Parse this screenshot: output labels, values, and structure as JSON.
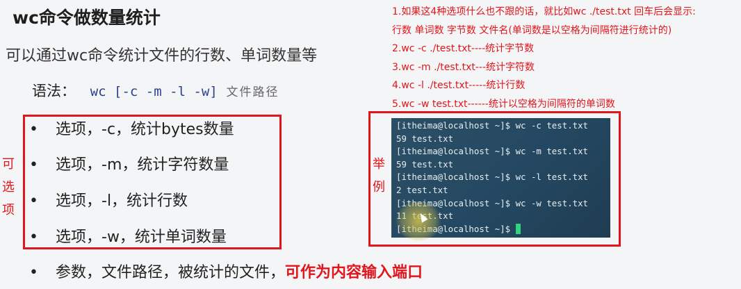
{
  "title": "wc命令做数量统计",
  "subtitle": "可以通过wc命令统计文件的行数、单词数量等",
  "syntax": {
    "label": "语法：",
    "code_cmd": "wc [",
    "opt_c": "-c",
    "opt_m": "-m",
    "opt_l": "-l",
    "opt_w": "-w",
    "code_end": "]",
    "path": "文件路径"
  },
  "options": [
    {
      "bullet": "•",
      "text": "选项，-c，统计bytes数量"
    },
    {
      "bullet": "•",
      "text": "选项，-m，统计字符数量"
    },
    {
      "bullet": "•",
      "text": "选项，-l，统计行数"
    },
    {
      "bullet": "•",
      "text": "选项，-w，统计单词数量"
    }
  ],
  "param": {
    "bullet": "•",
    "text": "参数，文件路径，被统计的文件，",
    "highlight": "可作为内容输入端口"
  },
  "side_labels": {
    "left": [
      "可",
      "选",
      "项"
    ],
    "right": [
      "举",
      "例"
    ]
  },
  "notes": [
    "1.如果这4种选项什么也不跟的话，就比如wc ./test.txt  回车后会显示:",
    "行数 单词数 字节数 文件名(单词数是以空格为间隔符进行统计的)",
    "2.wc -c ./test.txt----统计字节数",
    "3.wc -m ./test.txt---统计字符数",
    "4.wc -l ./test.txt-----统计行数",
    "5.wc -w test.txt------统计以空格为间隔符的单词数"
  ],
  "terminal": [
    "[itheima@localhost ~]$ wc -c test.txt",
    "59 test.txt",
    "[itheima@localhost ~]$ wc -m test.txt",
    "59 test.txt",
    "[itheima@localhost ~]$ wc -l test.txt",
    "2 test.txt",
    "[itheima@localhost ~]$ wc -w test.txt",
    "11 test.txt",
    "[itheima@localhost ~]$ "
  ],
  "colors": {
    "accent_red": "#e0161c",
    "code_blue": "#2b3f8f",
    "terminal_bg": "#244861",
    "cursor_green": "#2fd47c"
  }
}
